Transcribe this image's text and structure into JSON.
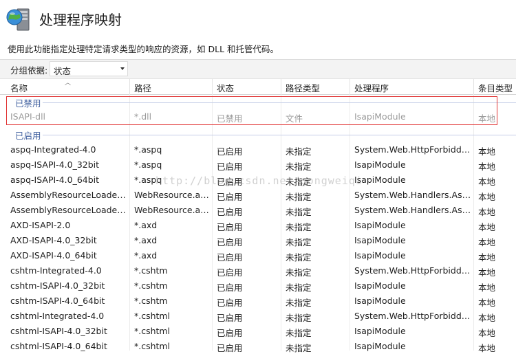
{
  "header": {
    "title": "处理程序映射",
    "description": "使用此功能指定处理特定请求类型的响应的资源，如 DLL 和托管代码。"
  },
  "groupby": {
    "label": "分组依据:",
    "value": "状态"
  },
  "columns": [
    "名称",
    "路径",
    "状态",
    "路径类型",
    "处理程序",
    "条目类型"
  ],
  "groups": [
    {
      "label": "已禁用",
      "rows": [
        [
          "ISAPI-dll",
          "*.dll",
          "已禁用",
          "文件",
          "IsapiModule",
          "本地"
        ]
      ]
    },
    {
      "label": "已启用",
      "rows": [
        [
          "aspq-Integrated-4.0",
          "*.aspq",
          "已启用",
          "未指定",
          "System.Web.HttpForbidde...",
          "本地"
        ],
        [
          "aspq-ISAPI-4.0_32bit",
          "*.aspq",
          "已启用",
          "未指定",
          "IsapiModule",
          "本地"
        ],
        [
          "aspq-ISAPI-4.0_64bit",
          "*.aspq",
          "已启用",
          "未指定",
          "IsapiModule",
          "本地"
        ],
        [
          "AssemblyResourceLoader-I...",
          "WebResource.axd",
          "已启用",
          "未指定",
          "System.Web.Handlers.Asse...",
          "本地"
        ],
        [
          "AssemblyResourceLoader-I...",
          "WebResource.axd",
          "已启用",
          "未指定",
          "System.Web.Handlers.Asse...",
          "本地"
        ],
        [
          "AXD-ISAPI-2.0",
          "*.axd",
          "已启用",
          "未指定",
          "IsapiModule",
          "本地"
        ],
        [
          "AXD-ISAPI-4.0_32bit",
          "*.axd",
          "已启用",
          "未指定",
          "IsapiModule",
          "本地"
        ],
        [
          "AXD-ISAPI-4.0_64bit",
          "*.axd",
          "已启用",
          "未指定",
          "IsapiModule",
          "本地"
        ],
        [
          "cshtm-Integrated-4.0",
          "*.cshtm",
          "已启用",
          "未指定",
          "System.Web.HttpForbidde...",
          "本地"
        ],
        [
          "cshtm-ISAPI-4.0_32bit",
          "*.cshtm",
          "已启用",
          "未指定",
          "IsapiModule",
          "本地"
        ],
        [
          "cshtm-ISAPI-4.0_64bit",
          "*.cshtm",
          "已启用",
          "未指定",
          "IsapiModule",
          "本地"
        ],
        [
          "cshtml-Integrated-4.0",
          "*.cshtml",
          "已启用",
          "未指定",
          "System.Web.HttpForbidde...",
          "本地"
        ],
        [
          "cshtml-ISAPI-4.0_32bit",
          "*.cshtml",
          "已启用",
          "未指定",
          "IsapiModule",
          "本地"
        ],
        [
          "cshtml-ISAPI-4.0_64bit",
          "*.cshtml",
          "已启用",
          "未指定",
          "IsapiModule",
          "本地"
        ]
      ]
    }
  ],
  "watermark": "http://blog.csdn.net/gongweiqi",
  "icons": {
    "app": "globe-server-icon",
    "dropdown": "chevron-down-icon",
    "sort": "sort-ascending-icon"
  },
  "colors": {
    "highlight": "#e03232",
    "group_label": "#3f5f9f"
  }
}
